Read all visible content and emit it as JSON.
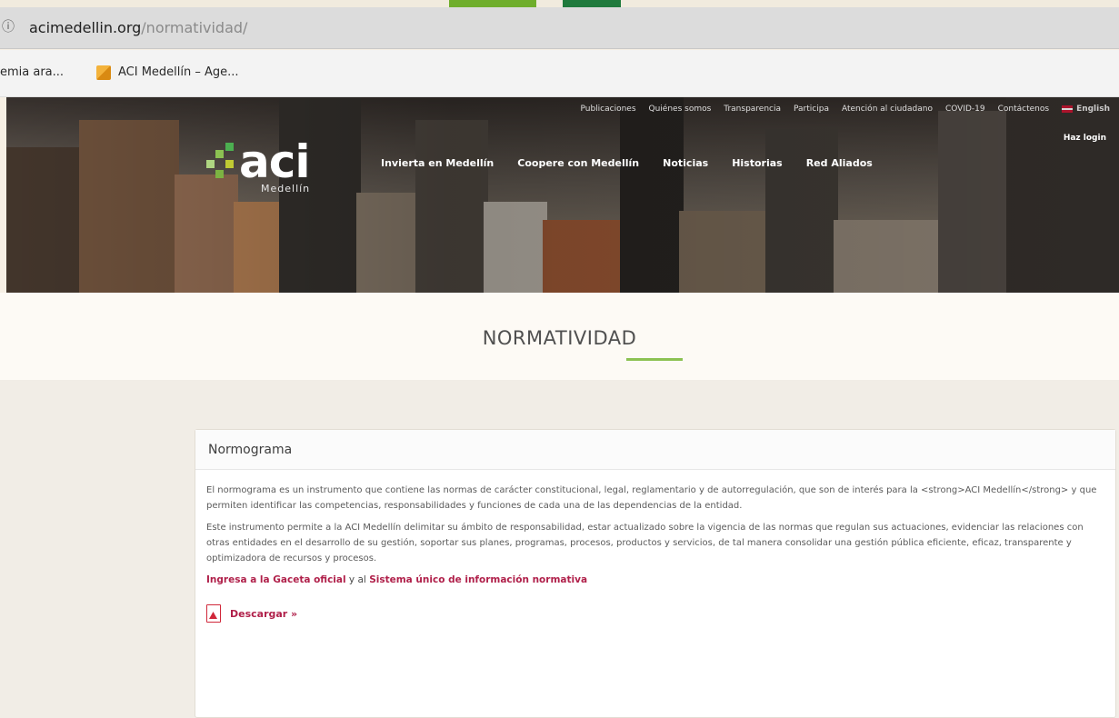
{
  "browser": {
    "url_domain": "acimedellin.org",
    "url_path": "/normatividad/",
    "bookmarks": [
      {
        "label": "emia ara..."
      },
      {
        "label": "ACI Medellín – Age..."
      }
    ]
  },
  "site": {
    "logo_text": "aci",
    "logo_sub": "Medellín",
    "utility_nav": [
      "Publicaciones",
      "Quiénes somos",
      "Transparencia",
      "Participa",
      "Atención al ciudadano",
      "COVID-19",
      "Contáctenos"
    ],
    "language_label": "English",
    "login_label": "Haz login",
    "main_nav": [
      "Invierta en Medellín",
      "Coopere con Medellín",
      "Noticias",
      "Historias",
      "Red Aliados"
    ]
  },
  "page": {
    "title": "NORMATIVIDAD"
  },
  "card": {
    "header": "Normograma",
    "paragraph1": "El normograma es un instrumento que contiene las normas de carácter constitucional, legal, reglamentario y de autorregulación, que son de interés para la <strong>ACI Medellín</strong> y que permiten identificar las competencias, responsabilidades y funciones de cada una de las dependencias de la entidad.",
    "paragraph2": "Este instrumento permite a la ACI Medellín delimitar su ámbito de responsabilidad, estar actualizado sobre la vigencia de las normas que regulan sus actuaciones, evidenciar las relaciones con otras entidades en el desarrollo de su gestión, soportar sus planes, programas, procesos, productos y servicios, de tal manera consolidar una gestión pública eficiente, eficaz, transparente y optimizadora de recursos y procesos.",
    "link1": "Ingresa a la Gaceta oficial",
    "link_joiner": " y al ",
    "link2": "Sistema único de información normativa",
    "download_label": "Descargar »"
  },
  "colors": {
    "accent_green": "#8cc152",
    "link_red": "#b0204a",
    "pdf_red": "#d0273a"
  }
}
